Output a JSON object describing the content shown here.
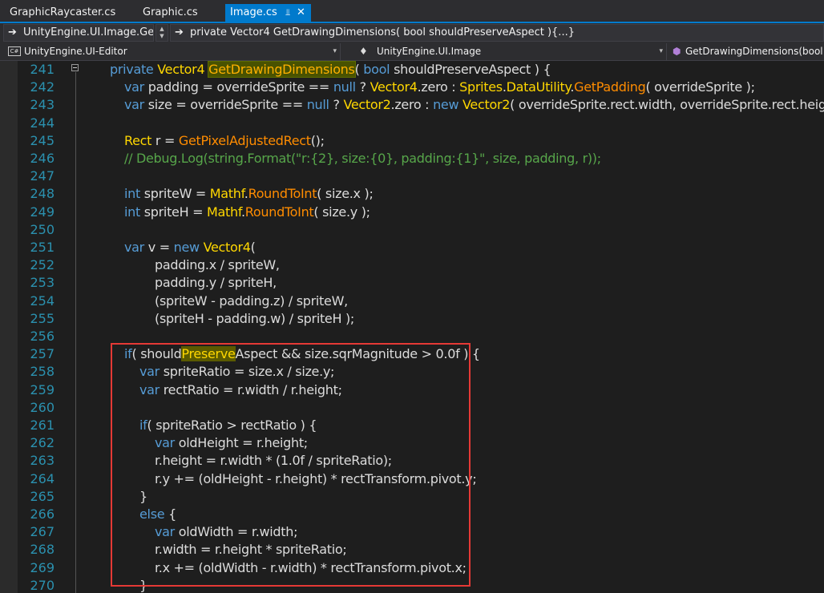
{
  "tabs": [
    {
      "label": "GraphicRaycaster.cs"
    },
    {
      "label": "Graphic.cs"
    },
    {
      "label": "Image.cs"
    }
  ],
  "tab_icons": {
    "pin": "pin-icon",
    "close": "close-icon"
  },
  "nav1": {
    "type_combo": "UnityEngine.UI.Image.Ge",
    "member_combo": "private Vector4 GetDrawingDimensions( bool shouldPreserveAspect ){...}"
  },
  "nav2": {
    "project": "UnityEngine.UI-Editor",
    "type": "UnityEngine.UI.Image",
    "member": "GetDrawingDimensions(bool s"
  },
  "lines": [
    {
      "n": "241"
    },
    {
      "n": "242"
    },
    {
      "n": "243"
    },
    {
      "n": "244"
    },
    {
      "n": "245"
    },
    {
      "n": "246"
    },
    {
      "n": "247"
    },
    {
      "n": "248"
    },
    {
      "n": "249"
    },
    {
      "n": "250"
    },
    {
      "n": "251"
    },
    {
      "n": "252"
    },
    {
      "n": "253"
    },
    {
      "n": "254"
    },
    {
      "n": "255"
    },
    {
      "n": "256"
    },
    {
      "n": "257"
    },
    {
      "n": "258"
    },
    {
      "n": "259"
    },
    {
      "n": "260"
    },
    {
      "n": "261"
    },
    {
      "n": "262"
    },
    {
      "n": "263"
    },
    {
      "n": "264"
    },
    {
      "n": "265"
    },
    {
      "n": "266"
    },
    {
      "n": "267"
    },
    {
      "n": "268"
    },
    {
      "n": "269"
    },
    {
      "n": "270"
    }
  ],
  "code": {
    "l241": [
      [
        "kw",
        "private "
      ],
      [
        "ty",
        "Vector4 "
      ],
      [
        "hl-def",
        "GetDrawingDimensions"
      ],
      [
        "",
        "( "
      ],
      [
        "kw",
        "bool "
      ],
      [
        "",
        "should"
      ],
      [
        "",
        "Preserve"
      ],
      [
        "",
        "Aspect ) {"
      ]
    ],
    "l242": [
      [
        "kw",
        "var "
      ],
      [
        "",
        "padding = overrideSprite == "
      ],
      [
        "kw",
        "null"
      ],
      [
        "",
        " ? "
      ],
      [
        "ty",
        "Vector4"
      ],
      [
        "",
        ".zero : "
      ],
      [
        "ty",
        "Sprites"
      ],
      [
        "",
        "."
      ],
      [
        "ty",
        "DataUtility"
      ],
      [
        "",
        "."
      ],
      [
        "fn",
        "GetPadding"
      ],
      [
        "",
        "( overrideSprite );"
      ]
    ],
    "l243": [
      [
        "kw",
        "var "
      ],
      [
        "",
        "size = overrideSprite == "
      ],
      [
        "kw",
        "null"
      ],
      [
        "",
        " ? "
      ],
      [
        "ty",
        "Vector2"
      ],
      [
        "",
        ".zero : "
      ],
      [
        "kw",
        "new "
      ],
      [
        "ty",
        "Vector2"
      ],
      [
        "",
        "( overrideSprite.rect.width, overrideSprite.rect.height );"
      ]
    ],
    "l244": [],
    "l245": [
      [
        "ty",
        "Rect "
      ],
      [
        "",
        "r = "
      ],
      [
        "fn",
        "GetPixelAdjustedRect"
      ],
      [
        "",
        "();"
      ]
    ],
    "l246": [
      [
        "cmt",
        "// Debug.Log(string.Format(\"r:{2}, size:{0}, padding:{1}\", size, padding, r));"
      ]
    ],
    "l247": [],
    "l248": [
      [
        "kw",
        "int "
      ],
      [
        "",
        "spriteW = "
      ],
      [
        "ty",
        "Mathf"
      ],
      [
        "",
        "."
      ],
      [
        "fn",
        "RoundToInt"
      ],
      [
        "",
        "( size.x );"
      ]
    ],
    "l249": [
      [
        "kw",
        "int "
      ],
      [
        "",
        "spriteH = "
      ],
      [
        "ty",
        "Mathf"
      ],
      [
        "",
        "."
      ],
      [
        "fn",
        "RoundToInt"
      ],
      [
        "",
        "( size.y );"
      ]
    ],
    "l250": [],
    "l251": [
      [
        "kw",
        "var "
      ],
      [
        "",
        "v = "
      ],
      [
        "kw",
        "new "
      ],
      [
        "ty",
        "Vector4"
      ],
      [
        "",
        "("
      ]
    ],
    "l252": [
      [
        "",
        "padding.x / spriteW,"
      ]
    ],
    "l253": [
      [
        "",
        "padding.y / spriteH,"
      ]
    ],
    "l254": [
      [
        "",
        "(spriteW - padding.z) / spriteW,"
      ]
    ],
    "l255": [
      [
        "",
        "(spriteH - padding.w) / spriteH );"
      ]
    ],
    "l256": [],
    "l257": [
      [
        "kw",
        "if"
      ],
      [
        "",
        "( should"
      ],
      [
        "hl-ref",
        "Preserve"
      ],
      [
        "",
        "Aspect && size.sqrMagnitude > 0.0f ) {"
      ]
    ],
    "l258": [
      [
        "kw",
        "var "
      ],
      [
        "",
        "spriteRatio = size.x / size.y;"
      ]
    ],
    "l259": [
      [
        "kw",
        "var "
      ],
      [
        "",
        "rectRatio = r.width / r.height;"
      ]
    ],
    "l260": [],
    "l261": [
      [
        "kw",
        "if"
      ],
      [
        "",
        "( spriteRatio > rectRatio ) {"
      ]
    ],
    "l262": [
      [
        "kw",
        "var "
      ],
      [
        "",
        "oldHeight = r.height;"
      ]
    ],
    "l263": [
      [
        "",
        "r.height = r.width * (1.0f / spriteRatio);"
      ]
    ],
    "l264": [
      [
        "",
        "r.y += (oldHeight - r.height) * rectTransform.pivot.y;"
      ]
    ],
    "l265": [
      [
        "",
        "}"
      ]
    ],
    "l266": [
      [
        "kw",
        "else "
      ],
      [
        "",
        "{"
      ]
    ],
    "l267": [
      [
        "kw",
        "var "
      ],
      [
        "",
        "oldWidth = r.width;"
      ]
    ],
    "l268": [
      [
        "",
        "r.width = r.height * spriteRatio;"
      ]
    ],
    "l269": [
      [
        "",
        "r.x += (oldWidth - r.width) * rectTransform.pivot.x;"
      ]
    ],
    "l270": [
      [
        "",
        "}"
      ]
    ]
  }
}
